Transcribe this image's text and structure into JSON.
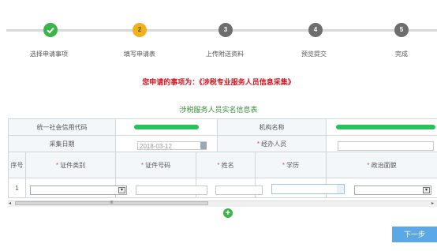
{
  "steps": [
    {
      "label": "选择申请事项",
      "state": "done",
      "icon": "check-icon"
    },
    {
      "label": "填写申请表",
      "state": "current",
      "number": "2"
    },
    {
      "label": "上传附送资料",
      "state": "todo",
      "number": "3"
    },
    {
      "label": "预览提交",
      "state": "todo",
      "number": "4"
    },
    {
      "label": "完成",
      "state": "todo",
      "number": "5"
    }
  ],
  "notice": "您申请的事项为：《涉税专业服务人员信息采集》",
  "form_title": "涉税服务人员实名信息表",
  "info": {
    "credit_code_label": "统一社会信用代码",
    "org_name_label": "机构名称",
    "collect_date_label": "采集日期",
    "collect_date_value": "2018-03-12",
    "agent_label": "经办人员",
    "required_mark": "*"
  },
  "columns": {
    "seq": "序号",
    "cert_type": "证件类别",
    "cert_no": "证件号码",
    "name": "姓名",
    "education": "学历",
    "politics": "政治面貌"
  },
  "rows": [
    {
      "seq": "1"
    }
  ],
  "scroll_glyphs": {
    "left": "◂",
    "right": "▸",
    "thumb": "III"
  },
  "select_arrow": "▾",
  "add_glyph": "+",
  "next_button": "下一步",
  "colors": {
    "done": "#3db34a",
    "current": "#f0b21c",
    "todo": "#6d6d6d",
    "accent_red": "#d2141f",
    "title_green": "#3a8a3a",
    "button_blue": "#5ba8e6"
  }
}
